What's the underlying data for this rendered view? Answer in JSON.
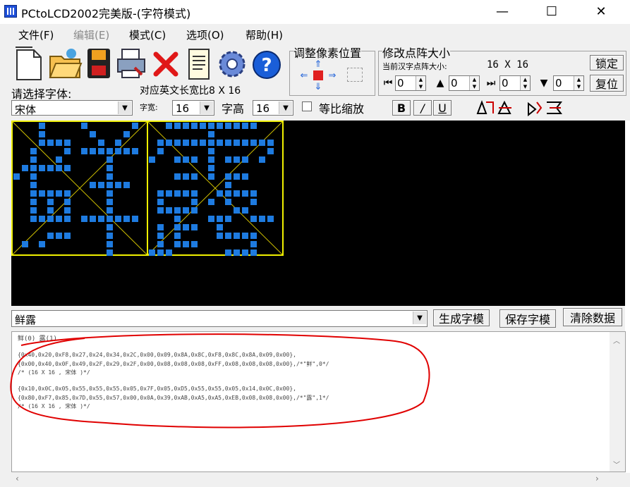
{
  "window": {
    "title": "PCtoLCD2002完美版-(字符模式)",
    "controls": {
      "minimize": "—",
      "maximize": "☐",
      "close": "✕"
    }
  },
  "menu": [
    "文件(F)",
    "编辑(E)",
    "模式(C)",
    "选项(O)",
    "帮助(H)"
  ],
  "adjust_group": {
    "title": "调整像素位置"
  },
  "size_group": {
    "title": "修改点阵大小",
    "current_label": "当前汉字点阵大小:",
    "current_value": "16  X  16",
    "lock_button": "锁定",
    "reset_button": "复位",
    "spinners": [
      "0",
      "0",
      "0",
      "0"
    ]
  },
  "font_row": {
    "choose_label": "请选择字体:",
    "ratio_label": "对应英文长宽比8 X 16",
    "font_value": "宋体",
    "width_label": "字宽:",
    "width_value": "16",
    "height_label": "字高",
    "height_value": "16",
    "proportional_label": "等比缩放",
    "bold": "B",
    "italic": "/",
    "underline": "U"
  },
  "input": {
    "text": "鲜露",
    "generate_button": "生成字模",
    "save_button": "保存字模",
    "clear_button": "清除数据"
  },
  "output": {
    "header": "鲜(0) 露(1)",
    "lines": [
      "{0x40,0x20,0xF8,0x27,0x24,0x34,0x2C,0x00,0x09,0x8A,0x8C,0xF8,0x8C,0x8A,0x09,0x00},",
      "{0x00,0x40,0x0F,0x49,0x2F,0x29,0x2F,0x00,0x08,0x08,0x08,0xFF,0x08,0x08,0x08,0x00},/*\"鲜\",0*/",
      "/* (16 X 16 , 宋体 )*/",
      "",
      "{0x10,0x0C,0x05,0x55,0x55,0x55,0x05,0x7F,0x05,0xD5,0x55,0x55,0x05,0x14,0x0C,0x00},",
      "{0x80,0xF7,0x85,0x7D,0x55,0x57,0x00,0x0A,0x39,0xAB,0xA5,0xA5,0xEB,0x08,0x08,0x00},/*\"露\",1*/",
      "/* (16 X 16 , 宋体 )*/"
    ]
  },
  "icons": [
    "new-file-icon",
    "open-folder-icon",
    "save-disk-icon",
    "print-icon",
    "delete-x-icon",
    "notepad-icon",
    "gear-icon",
    "help-icon"
  ],
  "colors": {
    "pixel": "#1E7BE0",
    "glyph_border": "#F0F000",
    "annotation": "#E00000"
  }
}
